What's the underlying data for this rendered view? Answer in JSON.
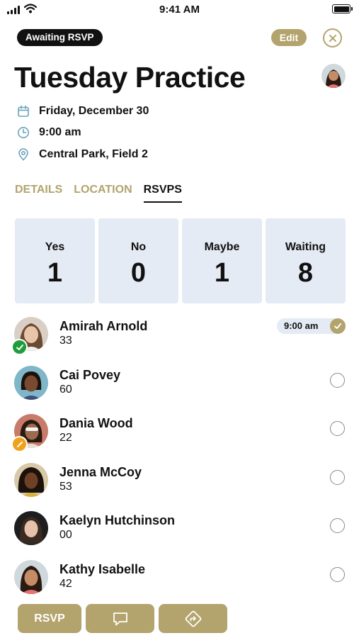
{
  "status_bar": {
    "time": "9:41 AM"
  },
  "header": {
    "badge": "Awaiting RSVP",
    "edit_label": "Edit",
    "title": "Tuesday Practice"
  },
  "event": {
    "date": "Friday, December 30",
    "time": "9:00 am",
    "location": "Central Park, Field 2"
  },
  "tabs": [
    {
      "label": "DETAILS",
      "active": false
    },
    {
      "label": "LOCATION",
      "active": false
    },
    {
      "label": "RSVPS",
      "active": true
    }
  ],
  "stats": [
    {
      "label": "Yes",
      "value": "1"
    },
    {
      "label": "No",
      "value": "0"
    },
    {
      "label": "Maybe",
      "value": "1"
    },
    {
      "label": "Waiting",
      "value": "8"
    }
  ],
  "members": [
    {
      "name": "Amirah Arnold",
      "number": "33",
      "status": "yes",
      "time": "9:00 am"
    },
    {
      "name": "Cai Povey",
      "number": "60",
      "status": "waiting"
    },
    {
      "name": "Dania Wood",
      "number": "22",
      "status": "maybe"
    },
    {
      "name": "Jenna McCoy",
      "number": "53",
      "status": "waiting"
    },
    {
      "name": "Kaelyn Hutchinson",
      "number": "00",
      "status": "waiting"
    },
    {
      "name": "Kathy Isabelle",
      "number": "42",
      "status": "waiting"
    }
  ],
  "toolbar": {
    "rsvp_label": "RSVP"
  },
  "colors": {
    "accent": "#b3a36d",
    "stat_bg": "#e4ebf4",
    "yes": "#1f9d3a",
    "maybe": "#f0a21c"
  }
}
